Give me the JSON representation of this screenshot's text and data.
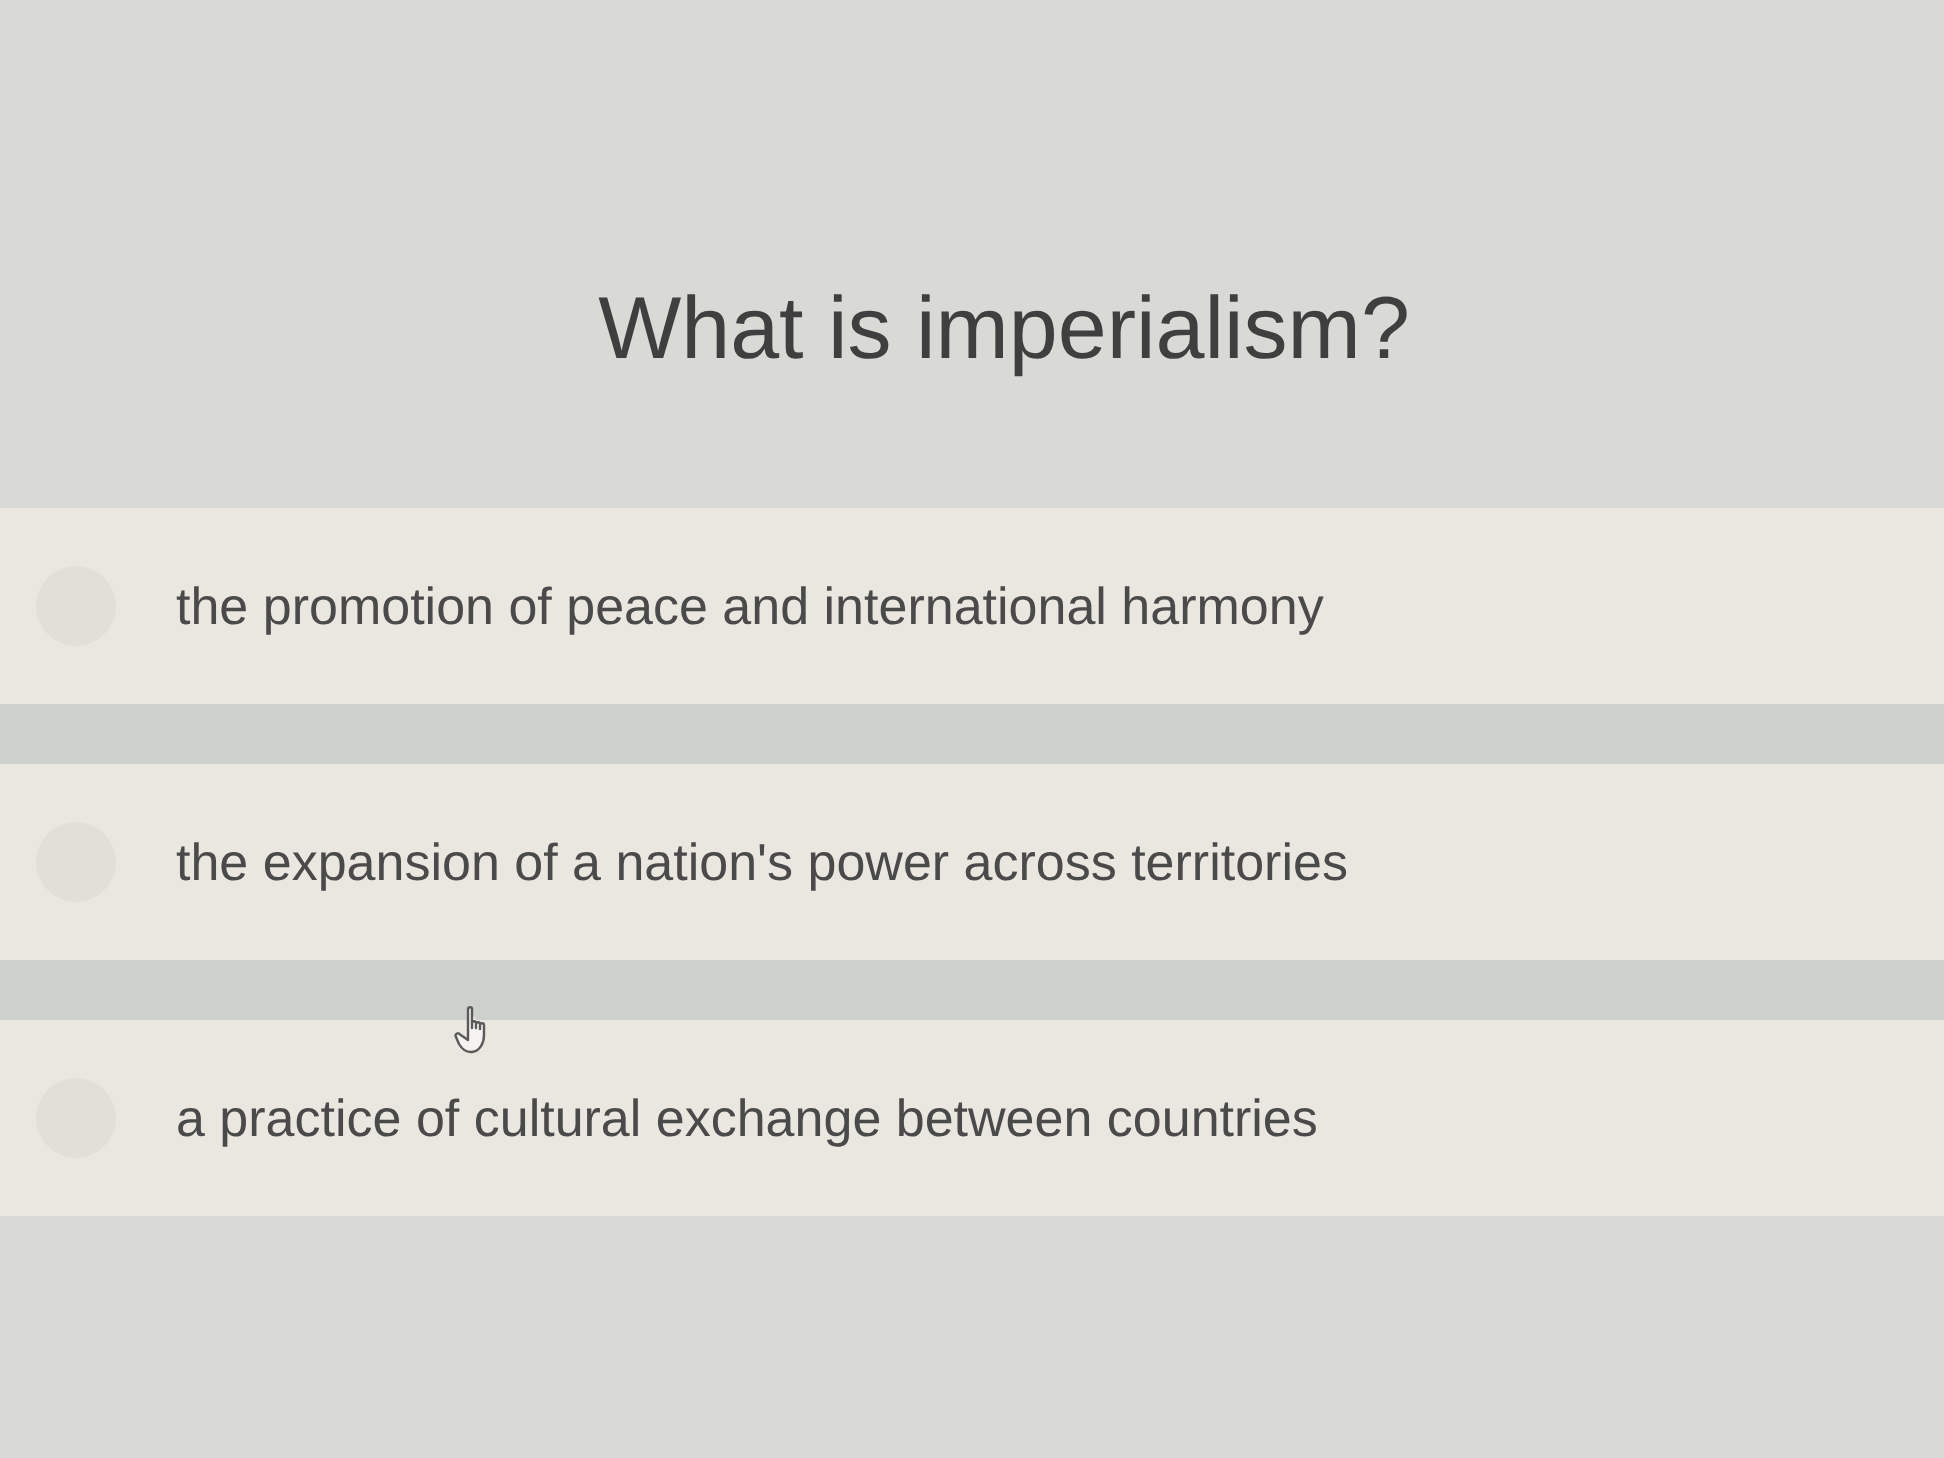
{
  "question": {
    "title": "What is imperialism?"
  },
  "options": [
    {
      "label": "the promotion of peace and international harmony",
      "selected": false
    },
    {
      "label": "the expansion of a nation's power across territories",
      "selected": false
    },
    {
      "label": "a practice of cultural exchange between countries",
      "selected": false
    }
  ]
}
